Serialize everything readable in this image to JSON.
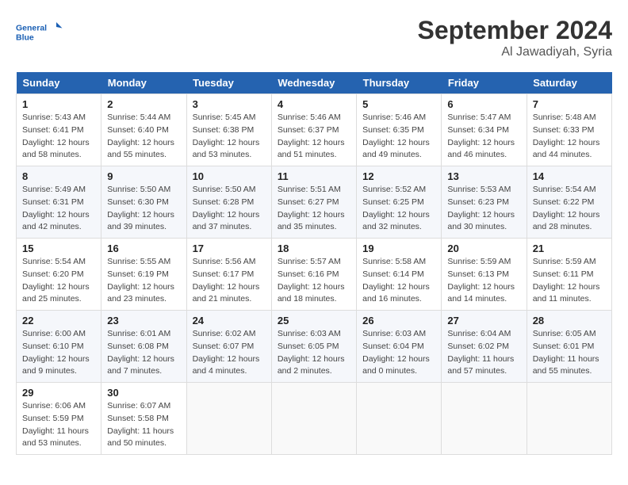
{
  "header": {
    "logo_line1": "General",
    "logo_line2": "Blue",
    "month": "September 2024",
    "location": "Al Jawadiyah, Syria"
  },
  "weekdays": [
    "Sunday",
    "Monday",
    "Tuesday",
    "Wednesday",
    "Thursday",
    "Friday",
    "Saturday"
  ],
  "weeks": [
    [
      {
        "day": "1",
        "sunrise": "Sunrise: 5:43 AM",
        "sunset": "Sunset: 6:41 PM",
        "daylight": "Daylight: 12 hours and 58 minutes."
      },
      {
        "day": "2",
        "sunrise": "Sunrise: 5:44 AM",
        "sunset": "Sunset: 6:40 PM",
        "daylight": "Daylight: 12 hours and 55 minutes."
      },
      {
        "day": "3",
        "sunrise": "Sunrise: 5:45 AM",
        "sunset": "Sunset: 6:38 PM",
        "daylight": "Daylight: 12 hours and 53 minutes."
      },
      {
        "day": "4",
        "sunrise": "Sunrise: 5:46 AM",
        "sunset": "Sunset: 6:37 PM",
        "daylight": "Daylight: 12 hours and 51 minutes."
      },
      {
        "day": "5",
        "sunrise": "Sunrise: 5:46 AM",
        "sunset": "Sunset: 6:35 PM",
        "daylight": "Daylight: 12 hours and 49 minutes."
      },
      {
        "day": "6",
        "sunrise": "Sunrise: 5:47 AM",
        "sunset": "Sunset: 6:34 PM",
        "daylight": "Daylight: 12 hours and 46 minutes."
      },
      {
        "day": "7",
        "sunrise": "Sunrise: 5:48 AM",
        "sunset": "Sunset: 6:33 PM",
        "daylight": "Daylight: 12 hours and 44 minutes."
      }
    ],
    [
      {
        "day": "8",
        "sunrise": "Sunrise: 5:49 AM",
        "sunset": "Sunset: 6:31 PM",
        "daylight": "Daylight: 12 hours and 42 minutes."
      },
      {
        "day": "9",
        "sunrise": "Sunrise: 5:50 AM",
        "sunset": "Sunset: 6:30 PM",
        "daylight": "Daylight: 12 hours and 39 minutes."
      },
      {
        "day": "10",
        "sunrise": "Sunrise: 5:50 AM",
        "sunset": "Sunset: 6:28 PM",
        "daylight": "Daylight: 12 hours and 37 minutes."
      },
      {
        "day": "11",
        "sunrise": "Sunrise: 5:51 AM",
        "sunset": "Sunset: 6:27 PM",
        "daylight": "Daylight: 12 hours and 35 minutes."
      },
      {
        "day": "12",
        "sunrise": "Sunrise: 5:52 AM",
        "sunset": "Sunset: 6:25 PM",
        "daylight": "Daylight: 12 hours and 32 minutes."
      },
      {
        "day": "13",
        "sunrise": "Sunrise: 5:53 AM",
        "sunset": "Sunset: 6:23 PM",
        "daylight": "Daylight: 12 hours and 30 minutes."
      },
      {
        "day": "14",
        "sunrise": "Sunrise: 5:54 AM",
        "sunset": "Sunset: 6:22 PM",
        "daylight": "Daylight: 12 hours and 28 minutes."
      }
    ],
    [
      {
        "day": "15",
        "sunrise": "Sunrise: 5:54 AM",
        "sunset": "Sunset: 6:20 PM",
        "daylight": "Daylight: 12 hours and 25 minutes."
      },
      {
        "day": "16",
        "sunrise": "Sunrise: 5:55 AM",
        "sunset": "Sunset: 6:19 PM",
        "daylight": "Daylight: 12 hours and 23 minutes."
      },
      {
        "day": "17",
        "sunrise": "Sunrise: 5:56 AM",
        "sunset": "Sunset: 6:17 PM",
        "daylight": "Daylight: 12 hours and 21 minutes."
      },
      {
        "day": "18",
        "sunrise": "Sunrise: 5:57 AM",
        "sunset": "Sunset: 6:16 PM",
        "daylight": "Daylight: 12 hours and 18 minutes."
      },
      {
        "day": "19",
        "sunrise": "Sunrise: 5:58 AM",
        "sunset": "Sunset: 6:14 PM",
        "daylight": "Daylight: 12 hours and 16 minutes."
      },
      {
        "day": "20",
        "sunrise": "Sunrise: 5:59 AM",
        "sunset": "Sunset: 6:13 PM",
        "daylight": "Daylight: 12 hours and 14 minutes."
      },
      {
        "day": "21",
        "sunrise": "Sunrise: 5:59 AM",
        "sunset": "Sunset: 6:11 PM",
        "daylight": "Daylight: 12 hours and 11 minutes."
      }
    ],
    [
      {
        "day": "22",
        "sunrise": "Sunrise: 6:00 AM",
        "sunset": "Sunset: 6:10 PM",
        "daylight": "Daylight: 12 hours and 9 minutes."
      },
      {
        "day": "23",
        "sunrise": "Sunrise: 6:01 AM",
        "sunset": "Sunset: 6:08 PM",
        "daylight": "Daylight: 12 hours and 7 minutes."
      },
      {
        "day": "24",
        "sunrise": "Sunrise: 6:02 AM",
        "sunset": "Sunset: 6:07 PM",
        "daylight": "Daylight: 12 hours and 4 minutes."
      },
      {
        "day": "25",
        "sunrise": "Sunrise: 6:03 AM",
        "sunset": "Sunset: 6:05 PM",
        "daylight": "Daylight: 12 hours and 2 minutes."
      },
      {
        "day": "26",
        "sunrise": "Sunrise: 6:03 AM",
        "sunset": "Sunset: 6:04 PM",
        "daylight": "Daylight: 12 hours and 0 minutes."
      },
      {
        "day": "27",
        "sunrise": "Sunrise: 6:04 AM",
        "sunset": "Sunset: 6:02 PM",
        "daylight": "Daylight: 11 hours and 57 minutes."
      },
      {
        "day": "28",
        "sunrise": "Sunrise: 6:05 AM",
        "sunset": "Sunset: 6:01 PM",
        "daylight": "Daylight: 11 hours and 55 minutes."
      }
    ],
    [
      {
        "day": "29",
        "sunrise": "Sunrise: 6:06 AM",
        "sunset": "Sunset: 5:59 PM",
        "daylight": "Daylight: 11 hours and 53 minutes."
      },
      {
        "day": "30",
        "sunrise": "Sunrise: 6:07 AM",
        "sunset": "Sunset: 5:58 PM",
        "daylight": "Daylight: 11 hours and 50 minutes."
      },
      null,
      null,
      null,
      null,
      null
    ]
  ]
}
